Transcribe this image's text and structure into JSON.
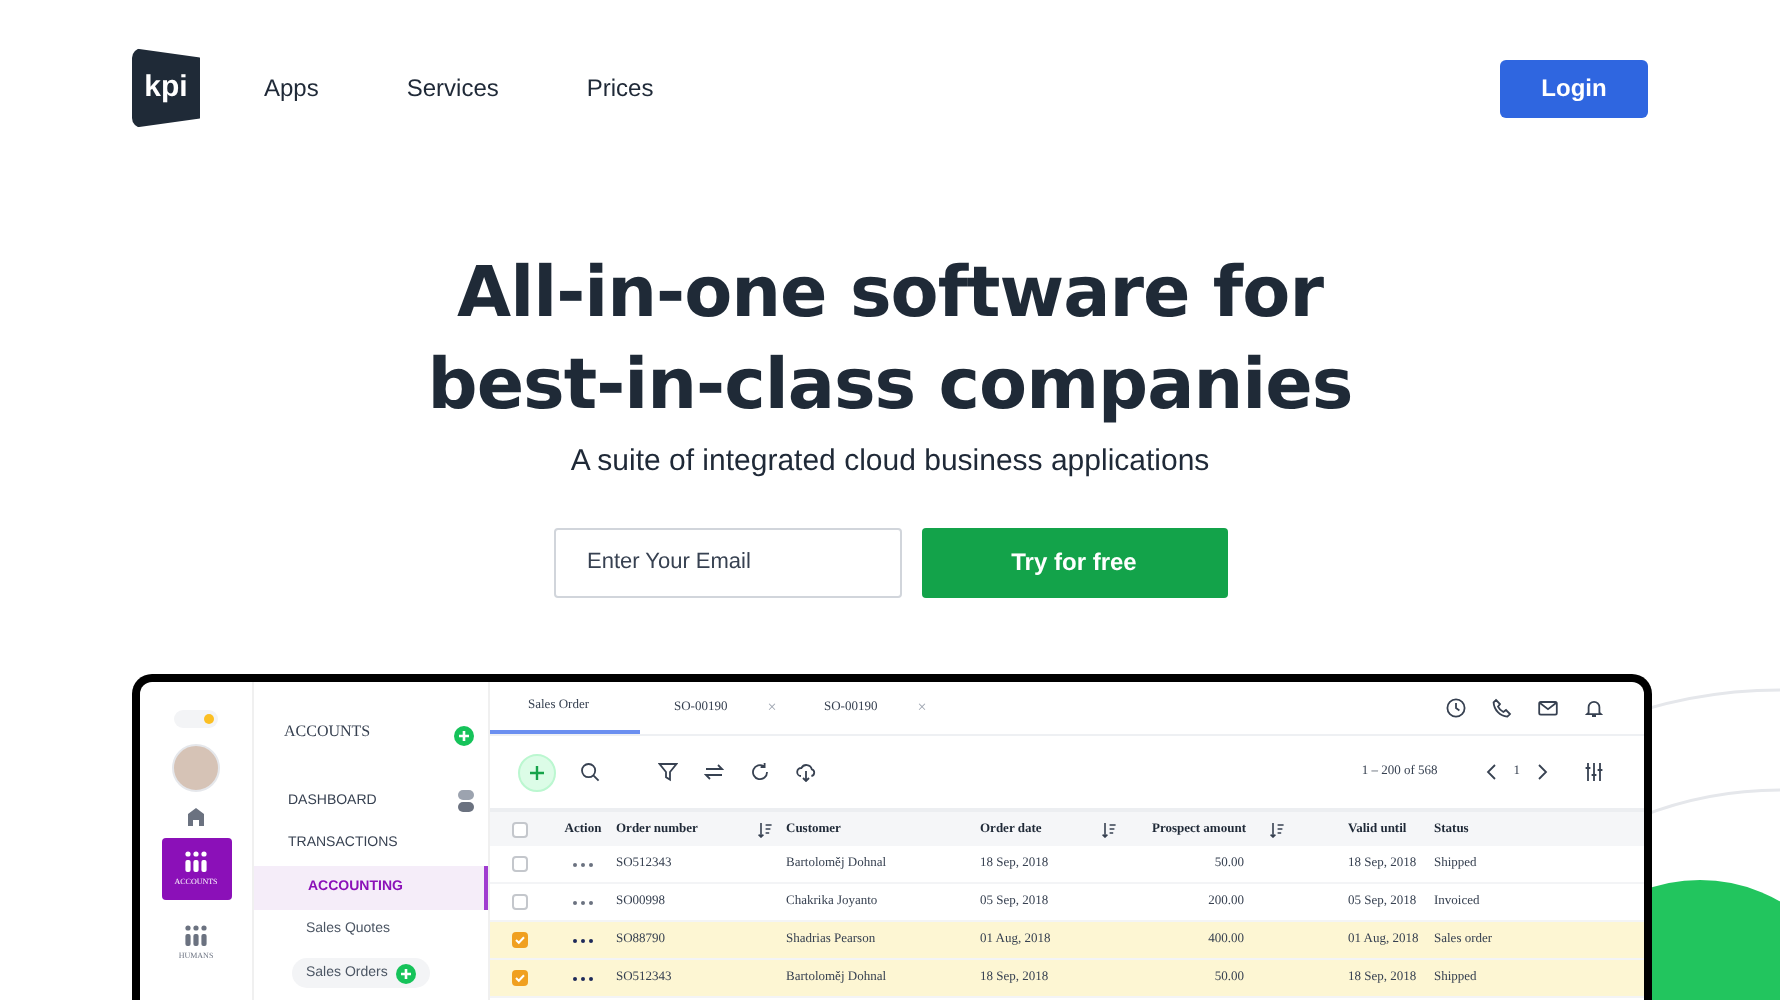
{
  "header": {
    "logo": "kpi",
    "nav": [
      {
        "label": "Apps"
      },
      {
        "label": "Services"
      },
      {
        "label": "Prices"
      }
    ],
    "login": "Login"
  },
  "hero": {
    "title_lines": [
      "All-in-one software for",
      "best-in-class companies"
    ],
    "subtitle": "A suite of integrated cloud business applications",
    "email": {
      "placeholder": "Enter Your Email"
    },
    "cta": "Try for free"
  },
  "app": {
    "rail": {
      "theme_toggle_on": true,
      "items": [
        {
          "label": "ACCOUNTS",
          "selected": true
        },
        {
          "label": "HUMANS",
          "selected": false
        }
      ]
    },
    "sidebar": {
      "title": "ACCOUNTS",
      "items": [
        {
          "label": "DASHBOARD",
          "kind": "section",
          "selected": false,
          "has_action": true
        },
        {
          "label": "TRANSACTIONS",
          "kind": "section",
          "selected": false,
          "has_action": false
        },
        {
          "label": "ACCOUNTING",
          "kind": "sub",
          "selected": true,
          "has_action": false
        },
        {
          "label": "Sales Quotes",
          "kind": "link",
          "selected": false,
          "has_action": false
        },
        {
          "label": "Sales Orders",
          "kind": "link",
          "selected": false,
          "has_action": true
        }
      ]
    },
    "tabs": [
      {
        "label": "Sales Order",
        "selected": true,
        "closable": false
      },
      {
        "label": "SO-00190",
        "selected": false,
        "closable": true,
        "close": "×"
      },
      {
        "label": "SO-00190",
        "selected": false,
        "closable": true,
        "close": "×"
      }
    ],
    "pagination": {
      "range": "1 – 200 of 568",
      "page": "1"
    },
    "table": {
      "header_checkbox": {
        "checked": false
      },
      "action_label": "Action",
      "columns": [
        {
          "label": "Order number",
          "sortable": true
        },
        {
          "label": "Customer",
          "sortable": false
        },
        {
          "label": "Order date",
          "sortable": true
        },
        {
          "label": "Prospect amount",
          "sortable": true
        },
        {
          "label": "Valid until",
          "sortable": false
        },
        {
          "label": "Status",
          "sortable": false
        }
      ],
      "rows": [
        {
          "checked": false,
          "cells": [
            "SO512343",
            "Bartoloměj Dohnal",
            "18 Sep, 2018",
            "50.00",
            "18 Sep, 2018",
            "Shipped"
          ]
        },
        {
          "checked": false,
          "cells": [
            "SO00998",
            "Chakrika Joyanto",
            "05 Sep, 2018",
            "200.00",
            "05 Sep, 2018",
            "Invoiced"
          ]
        },
        {
          "checked": true,
          "cells": [
            "SO88790",
            "Shadrias Pearson",
            "01 Aug, 2018",
            "400.00",
            "01 Aug, 2018",
            "Sales order"
          ]
        },
        {
          "checked": true,
          "cells": [
            "SO512343",
            "Bartoloměj Dohnal",
            "18 Sep, 2018",
            "50.00",
            "18 Sep, 2018",
            "Shipped"
          ]
        }
      ]
    }
  }
}
